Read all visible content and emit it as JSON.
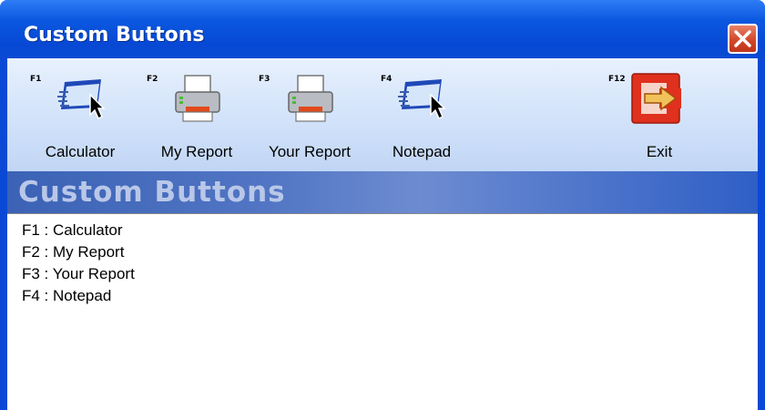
{
  "window": {
    "title": "Custom Buttons"
  },
  "toolbar": {
    "buttons": [
      {
        "key": "F1",
        "label": "Calculator",
        "icon": "window-cursor-icon"
      },
      {
        "key": "F2",
        "label": "My Report",
        "icon": "printer-icon"
      },
      {
        "key": "F3",
        "label": "Your Report",
        "icon": "printer-icon"
      },
      {
        "key": "F4",
        "label": "Notepad",
        "icon": "window-cursor-icon"
      },
      {
        "key": "F12",
        "label": "Exit",
        "icon": "exit-door-icon"
      }
    ]
  },
  "section": {
    "title": "Custom Buttons"
  },
  "list": {
    "lines": [
      "F1 : Calculator",
      "F2 : My Report",
      "F3 : Your Report",
      "F4 : Notepad"
    ]
  },
  "colors": {
    "titlebar": "#0a4ad2",
    "close_button": "#d1482a",
    "toolbar": "#d7e6fb",
    "section_header": "#4f72c1",
    "exit_icon": "#e0301e"
  }
}
